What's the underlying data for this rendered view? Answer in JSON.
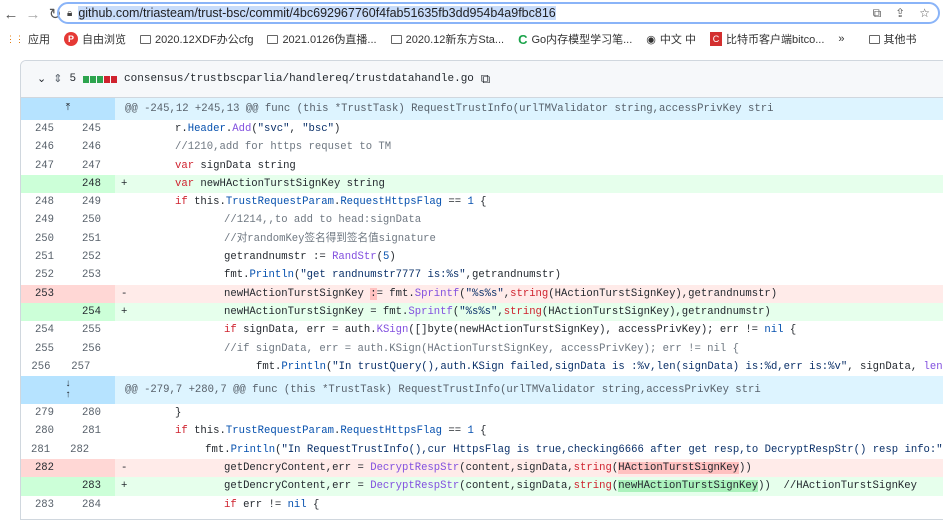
{
  "browser": {
    "url": "github.com/triasteam/trust-bsc/commit/4bc692967760f4fab51635fb3dd954b4a9fbc816",
    "bookmarks": [
      {
        "icon": "apps-grid-icon",
        "label": "应用"
      },
      {
        "icon": "p-icon",
        "label": "自由浏览"
      },
      {
        "icon": "folder-icon",
        "label": "2020.12XDF办公cfg"
      },
      {
        "icon": "folder-icon",
        "label": "2021.0126伪直播..."
      },
      {
        "icon": "folder-icon",
        "label": "2020.12新东方Sta..."
      },
      {
        "icon": "c-icon",
        "label": "Go内存模型学习笔..."
      },
      {
        "icon": "globe-icon",
        "label": "中文 中"
      },
      {
        "icon": "c-red-icon",
        "label": "比特币客户端bitco..."
      },
      {
        "icon": "folder-icon",
        "label": "其他书"
      }
    ],
    "more": "»"
  },
  "file": {
    "changes": "5",
    "path": "consensus/trustbscparlia/handlereq/trustdatahandle.go",
    "bar_colors": [
      "#2da44e",
      "#2da44e",
      "#2da44e",
      "#cf222e",
      "#cf222e"
    ]
  },
  "hunks": [
    {
      "header": "@@ -245,12 +245,13 @@ func (this *TrustTask) RequestTrustInfo(urlTMValidator string,accessPrivKey stri",
      "lines": [
        {
          "t": "ctx",
          "o": "245",
          "n": "245",
          "i": 2,
          "tok": [
            [
              "r.",
              ""
            ],
            [
              "Header",
              "f"
            ],
            [
              ".",
              ""
            ],
            [
              "Add",
              "p"
            ],
            [
              "(",
              ""
            ],
            [
              "\"svc\"",
              "s"
            ],
            [
              ", ",
              ""
            ],
            [
              "\"bsc\"",
              "s"
            ],
            [
              ")",
              ""
            ]
          ]
        },
        {
          "t": "ctx",
          "o": "246",
          "n": "246",
          "i": 2,
          "tok": [
            [
              "//1210,add for https requset to TM",
              "c"
            ]
          ]
        },
        {
          "t": "ctx",
          "o": "247",
          "n": "247",
          "i": 2,
          "tok": [
            [
              "var",
              "k"
            ],
            [
              " signData string",
              ""
            ]
          ]
        },
        {
          "t": "add",
          "o": "",
          "n": "248",
          "i": 2,
          "tok": [
            [
              "var",
              "k"
            ],
            [
              " newHActionTurstSignKey string",
              ""
            ]
          ]
        },
        {
          "t": "ctx",
          "o": "248",
          "n": "249",
          "i": 2,
          "tok": [
            [
              "if",
              "k"
            ],
            [
              " this.",
              ""
            ],
            [
              "TrustRequestParam",
              "f"
            ],
            [
              ".",
              ""
            ],
            [
              "RequestHttpsFlag",
              "f"
            ],
            [
              " == ",
              ""
            ],
            [
              "1",
              "f"
            ],
            [
              " {",
              ""
            ]
          ]
        },
        {
          "t": "ctx",
          "o": "249",
          "n": "250",
          "i": 3,
          "tok": [
            [
              "//1214,,to add to head:signData",
              "c"
            ]
          ]
        },
        {
          "t": "ctx",
          "o": "250",
          "n": "251",
          "i": 3,
          "tok": [
            [
              "//对randomKey签名得到签名值signature",
              "c"
            ]
          ]
        },
        {
          "t": "ctx",
          "o": "251",
          "n": "252",
          "i": 3,
          "tok": [
            [
              "getrandnumstr := ",
              ""
            ],
            [
              "RandStr",
              "p"
            ],
            [
              "(",
              ""
            ],
            [
              "5",
              "f"
            ],
            [
              ")",
              ""
            ]
          ]
        },
        {
          "t": "ctx",
          "o": "252",
          "n": "253",
          "i": 3,
          "tok": [
            [
              "fmt.",
              ""
            ],
            [
              "Println",
              "f"
            ],
            [
              "(",
              ""
            ],
            [
              "\"get randnumstr7777 is:%s\"",
              "s"
            ],
            [
              ",getrandnumstr)",
              ""
            ]
          ]
        },
        {
          "t": "del",
          "o": "253",
          "n": "",
          "i": 3,
          "tok": [
            [
              "newHActionTurstSignKey ",
              ""
            ],
            [
              ":",
              "hd"
            ],
            [
              "= fmt.",
              ""
            ],
            [
              "Sprintf",
              "p"
            ],
            [
              "(",
              ""
            ],
            [
              "\"%s%s\"",
              "s"
            ],
            [
              ",",
              ""
            ],
            [
              "string",
              "k"
            ],
            [
              "(HActionTurstSignKey),getrandnumstr)",
              ""
            ]
          ]
        },
        {
          "t": "add",
          "o": "",
          "n": "254",
          "i": 3,
          "tok": [
            [
              "newHActionTurstSignKey = fmt.",
              ""
            ],
            [
              "Sprintf",
              "p"
            ],
            [
              "(",
              ""
            ],
            [
              "\"%s%s\"",
              "s"
            ],
            [
              ",",
              ""
            ],
            [
              "string",
              "k"
            ],
            [
              "(HActionTurstSignKey),getrandnumstr)",
              ""
            ]
          ]
        },
        {
          "t": "ctx",
          "o": "254",
          "n": "255",
          "i": 3,
          "tok": [
            [
              "if",
              "k"
            ],
            [
              " signData, err = auth.",
              ""
            ],
            [
              "KSign",
              "p"
            ],
            [
              "([]byte(newHActionTurstSignKey), accessPrivKey); err != ",
              ""
            ],
            [
              "nil",
              "f"
            ],
            [
              " {",
              ""
            ]
          ]
        },
        {
          "t": "ctx",
          "o": "255",
          "n": "256",
          "i": 3,
          "tok": [
            [
              "//if signData, err = auth.KSign(HActionTurstSignKey, accessPrivKey); err != nil {",
              "c"
            ]
          ]
        },
        {
          "t": "ctx",
          "o": "256",
          "n": "257",
          "i": 4,
          "tok": [
            [
              "fmt.",
              ""
            ],
            [
              "Println",
              "f"
            ],
            [
              "(",
              ""
            ],
            [
              "\"In trustQuery(),auth.KSign failed,signData is :%v,len(signData) is:%d,err is:%v\"",
              "s"
            ],
            [
              ", signData, ",
              ""
            ],
            [
              "len",
              "p"
            ],
            [
              "(",
              ""
            ]
          ]
        }
      ]
    },
    {
      "header": "@@ -279,7 +280,7 @@ func (this *TrustTask) RequestTrustInfo(urlTMValidator string,accessPrivKey stri",
      "lines": [
        {
          "t": "ctx",
          "o": "279",
          "n": "280",
          "i": 2,
          "tok": [
            [
              "}",
              ""
            ]
          ]
        },
        {
          "t": "ctx",
          "o": "280",
          "n": "281",
          "i": 2,
          "tok": [
            [
              "if",
              "k"
            ],
            [
              " this.",
              ""
            ],
            [
              "TrustRequestParam",
              "f"
            ],
            [
              ".",
              ""
            ],
            [
              "RequestHttpsFlag",
              "f"
            ],
            [
              " == ",
              ""
            ],
            [
              "1",
              "f"
            ],
            [
              " {",
              ""
            ]
          ]
        },
        {
          "t": "ctx",
          "o": "281",
          "n": "282",
          "i": 3,
          "tok": [
            [
              "fmt.",
              ""
            ],
            [
              "Println",
              "f"
            ],
            [
              "(",
              ""
            ],
            [
              "\"In RequestTrustInfo(),cur HttpsFlag is true,checking6666 after get resp,to DecryptRespStr() resp info:\"",
              "s"
            ],
            [
              ")",
              ""
            ]
          ]
        },
        {
          "t": "del",
          "o": "282",
          "n": "",
          "i": 3,
          "tok": [
            [
              "getDencryContent,err = ",
              ""
            ],
            [
              "DecryptRespStr",
              "p"
            ],
            [
              "(content,signData,",
              ""
            ],
            [
              "string",
              "k"
            ],
            [
              "(",
              ""
            ],
            [
              "HActionTurstSignKey",
              "hd"
            ],
            [
              "))",
              ""
            ]
          ]
        },
        {
          "t": "add",
          "o": "",
          "n": "283",
          "i": 3,
          "tok": [
            [
              "getDencryContent,err = ",
              ""
            ],
            [
              "DecryptRespStr",
              "p"
            ],
            [
              "(content,signData,",
              ""
            ],
            [
              "string",
              "k"
            ],
            [
              "(",
              ""
            ],
            [
              "newHActionTurstSignKey",
              "ha"
            ],
            [
              "))  //HActionTurstSignKey",
              ""
            ]
          ]
        },
        {
          "t": "ctx",
          "o": "283",
          "n": "284",
          "i": 3,
          "tok": [
            [
              "if",
              "k"
            ],
            [
              " err != ",
              ""
            ],
            [
              "nil",
              "f"
            ],
            [
              " {",
              ""
            ]
          ]
        }
      ]
    }
  ]
}
